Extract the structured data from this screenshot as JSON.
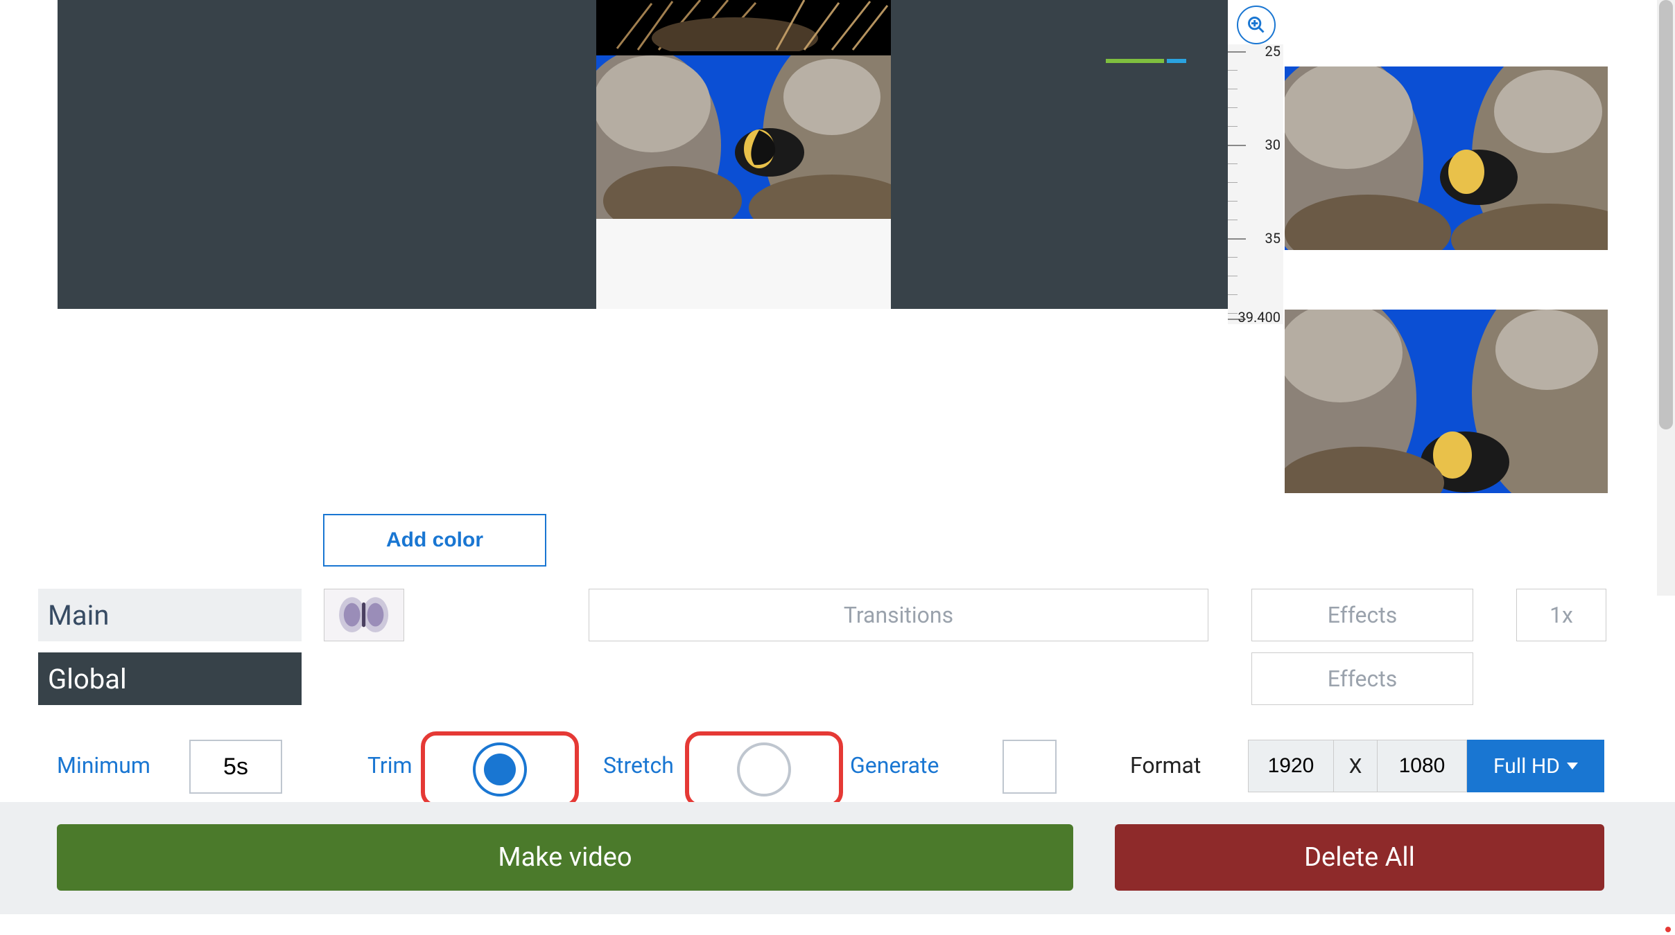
{
  "canvas": {
    "__": "preview"
  },
  "ruler": {
    "ticks": [
      "25",
      "30",
      "35",
      "39.400"
    ]
  },
  "add_color": "Add color",
  "tabs": {
    "main": "Main",
    "global": "Global"
  },
  "transitions_placeholder": "Transitions",
  "effects_placeholder": "Effects",
  "speed_placeholder": "1x",
  "options": {
    "minimum_label": "Minimum",
    "minimum_value": "5s",
    "trim_label": "Trim",
    "trim_selected": true,
    "stretch_label": "Stretch",
    "stretch_selected": false,
    "generate_label": "Generate",
    "generate_checked": false,
    "format_label": "Format",
    "format_width": "1920",
    "format_x": "X",
    "format_height": "1080",
    "format_preset": "Full HD"
  },
  "actions": {
    "make": "Make video",
    "delete": "Delete All"
  }
}
